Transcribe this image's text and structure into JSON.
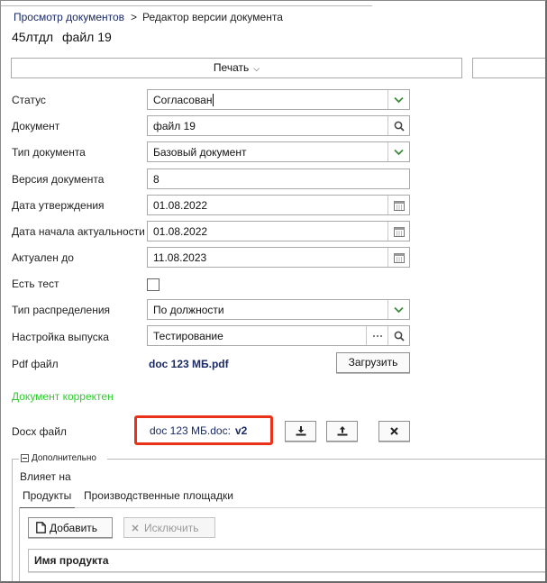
{
  "breadcrumb": {
    "parent": "Просмотр документов",
    "separator": ">",
    "current": "Редактор версии документа"
  },
  "document_header": {
    "code": "45лтдл",
    "name": "файл 19"
  },
  "toolbar": {
    "print_label": "Печать"
  },
  "form": {
    "status": {
      "label": "Статус",
      "value": "Согласован"
    },
    "document": {
      "label": "Документ",
      "value": "файл 19"
    },
    "doc_type": {
      "label": "Тип документа",
      "value": "Базовый документ"
    },
    "version": {
      "label": "Версия документа",
      "value": "8"
    },
    "approval_date": {
      "label": "Дата утверждения",
      "value": "01.08.2022"
    },
    "relevance_start": {
      "label": "Дата начала актуальности",
      "value": "01.08.2022"
    },
    "relevant_until": {
      "label": "Актуален до",
      "value": "11.08.2023"
    },
    "has_test": {
      "label": "Есть тест",
      "checked": false
    },
    "distribution_type": {
      "label": "Тип распределения",
      "value": "По должности"
    },
    "release_setting": {
      "label": "Настройка выпуска",
      "value": "Тестирование"
    },
    "pdf": {
      "label": "Pdf файл",
      "file_name": "doc 123 МБ.pdf",
      "upload_label": "Загрузить"
    },
    "status_message": "Документ корректен",
    "docx": {
      "label": "Docx файл",
      "file_name": "doc 123 МБ.doc:",
      "version": "v2"
    }
  },
  "extra": {
    "legend": "Дополнительно",
    "affects_label": "Влияет на",
    "tabs": [
      {
        "label": "Продукты",
        "active": true
      },
      {
        "label": "Производственные площадки",
        "active": false
      }
    ],
    "add_label": "Добавить",
    "exclude_label": "Исключить",
    "grid_column": "Имя продукта"
  },
  "colors": {
    "link": "#1a2a66",
    "ok_message": "#2fcc2f",
    "highlight": "#e8321a",
    "dropdown_chevron": "#3d8a3d"
  },
  "icons": {
    "dropdown": "chevron-down-icon",
    "lookup": "search-icon",
    "calendar": "calendar-icon",
    "more": "ellipsis-icon",
    "download": "download-icon",
    "upload": "upload-icon",
    "remove": "close-icon",
    "add": "document-icon",
    "exclude": "close-icon",
    "collapse": "minus-square-icon"
  }
}
